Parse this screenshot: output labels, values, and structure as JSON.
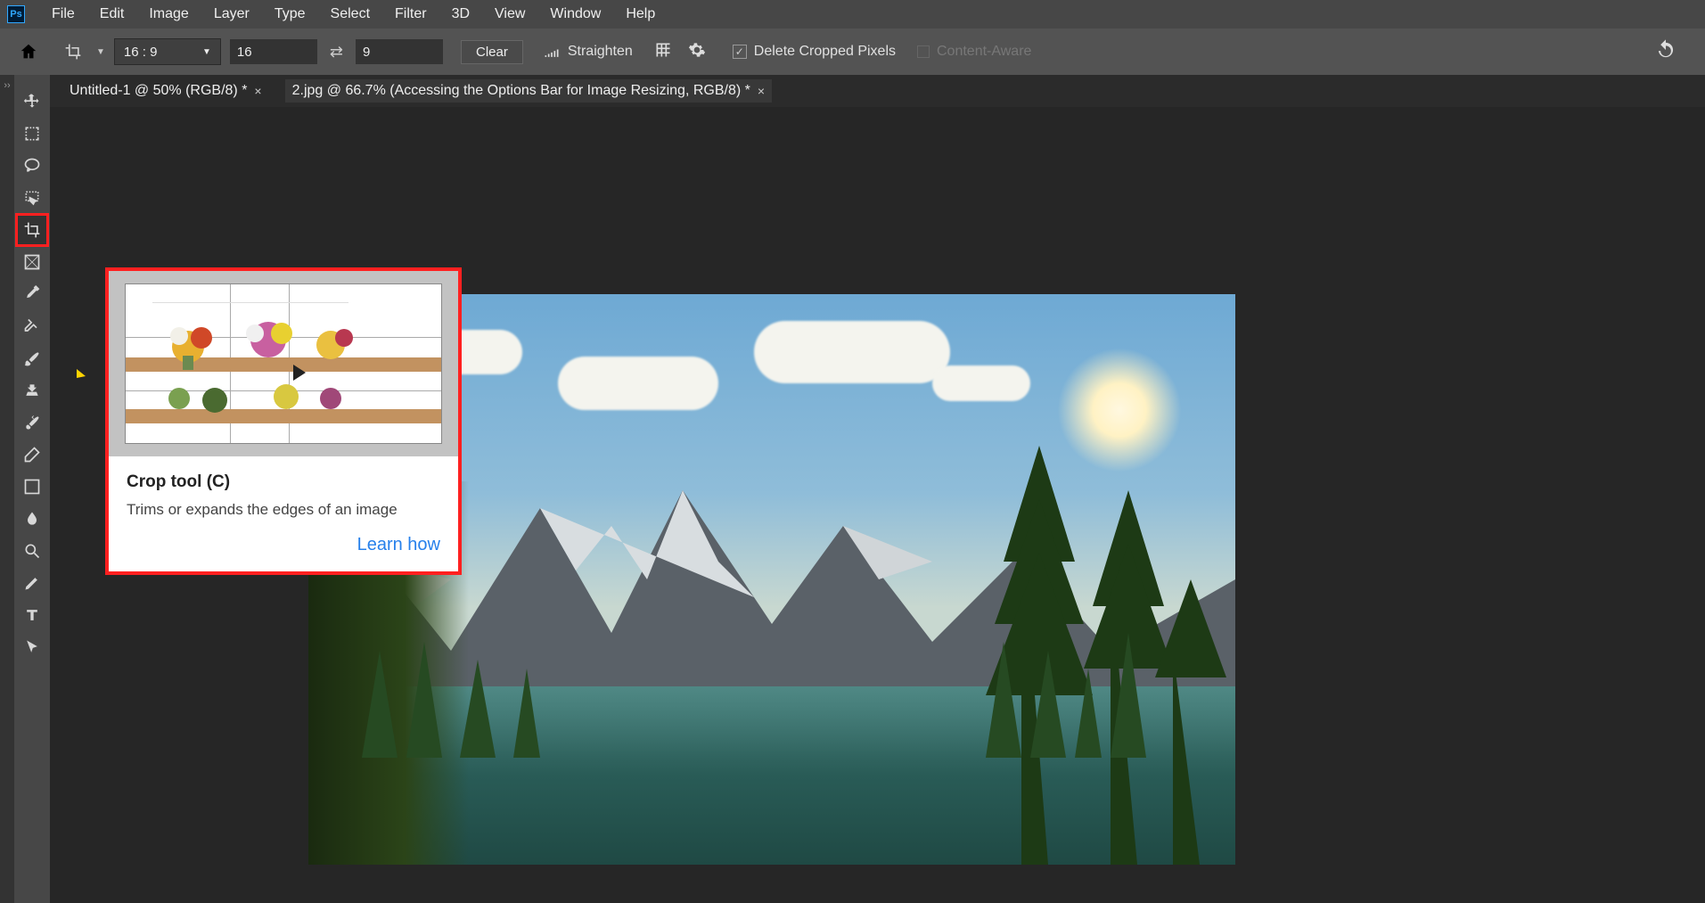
{
  "menu": [
    "File",
    "Edit",
    "Image",
    "Layer",
    "Type",
    "Select",
    "Filter",
    "3D",
    "View",
    "Window",
    "Help"
  ],
  "options": {
    "ratio": "16 : 9",
    "w": "16",
    "h": "9",
    "clear": "Clear",
    "straighten": "Straighten",
    "deleteCropped": "Delete Cropped Pixels",
    "contentAware": "Content-Aware"
  },
  "tabs": [
    {
      "label": "Untitled-1 @ 50% (RGB/8) *",
      "active": false
    },
    {
      "label": "2.jpg @ 66.7% (Accessing the Options Bar for Image Resizing, RGB/8) *",
      "active": true
    }
  ],
  "tooltip": {
    "title": "Crop tool (C)",
    "desc": "Trims or expands the edges of an image",
    "link": "Learn how"
  },
  "tools": [
    "move",
    "rect-marquee",
    "lasso",
    "quick-select",
    "crop",
    "frame",
    "eyedropper",
    "healing",
    "brush",
    "clone",
    "history-brush",
    "eraser",
    "gradient",
    "blur",
    "dodge",
    "pen",
    "type",
    "path-select"
  ]
}
